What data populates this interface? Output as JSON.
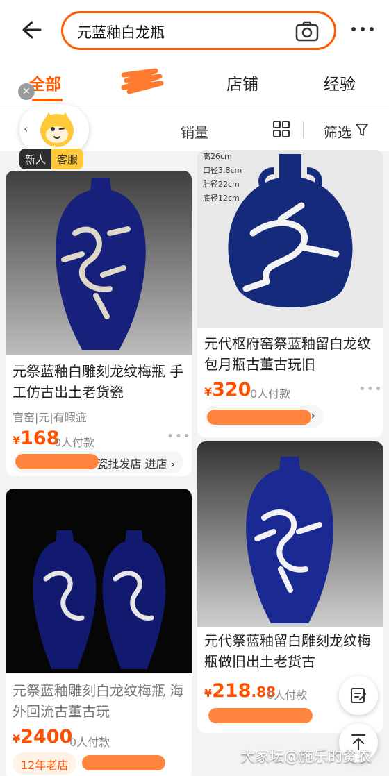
{
  "search": {
    "query": "元蓝釉白龙瓶"
  },
  "tabs": [
    {
      "label": "全部",
      "active": true
    },
    {
      "label": "",
      "redacted": true
    },
    {
      "label": "店铺"
    },
    {
      "label": "经验"
    }
  ],
  "filters": {
    "sales": "销量",
    "filter": "筛选"
  },
  "service_widget": {
    "new_label": "新人",
    "service_label": "客服"
  },
  "products": [
    {
      "title": "元祭蓝釉白雕刻龙纹梅瓶 手工仿古出土老货瓷",
      "tags": "官窑|元|有暇疵",
      "currency": "¥",
      "price": "168",
      "price_decimal": "",
      "sold": "0人付款",
      "shop": "瓷批发店 进店 ›"
    },
    {
      "title": "元代枢府窑祭蓝釉留白龙纹包月瓶古董古玩旧",
      "image_text": [
        "高26cm",
        "口径3.8cm",
        "肚径22cm",
        "底径12cm"
      ],
      "currency": "¥",
      "price": "320",
      "price_decimal": "",
      "sold": "0人付款",
      "shop": "›"
    },
    {
      "title": "元祭蓝釉雕刻白龙纹梅瓶 海外回流古董古玩",
      "currency": "¥",
      "price": "2400",
      "price_decimal": "",
      "sold": "0人付款",
      "shop": "12年老店"
    },
    {
      "title": "元代祭蓝釉留白雕刻龙纹梅瓶做旧出土老货古",
      "currency": "¥",
      "price": "218",
      "price_decimal": ".88",
      "sold": "0人付款",
      "shop": ""
    }
  ],
  "watermark": "大家坛@施乐的贫农",
  "colors": {
    "accent": "#ff5000",
    "tab_active": "#ff5a00",
    "redaction": "#ff7a2e"
  },
  "icons": [
    "back-arrow-icon",
    "camera-icon",
    "more-icon",
    "grid-view-icon",
    "funnel-icon",
    "close-icon",
    "edit-icon",
    "back-to-top-icon"
  ]
}
